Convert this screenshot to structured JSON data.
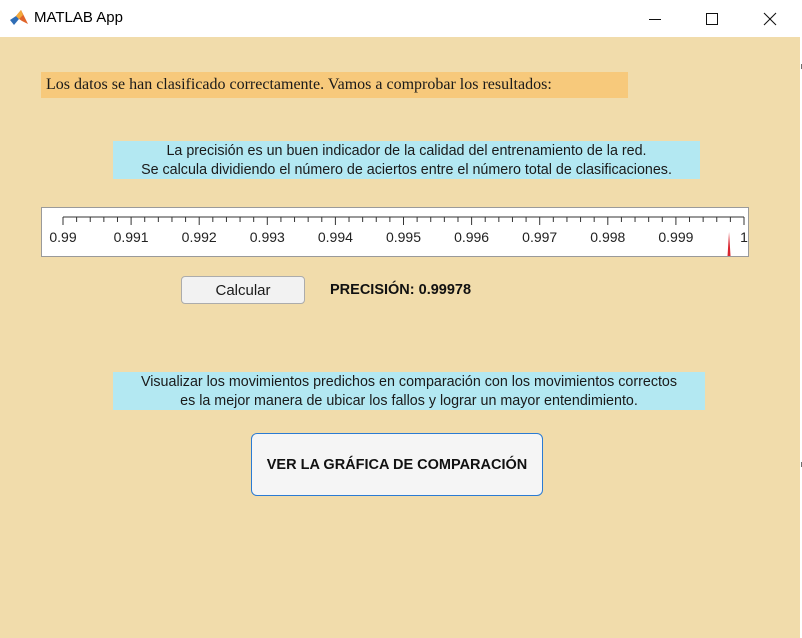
{
  "window": {
    "title": "MATLAB App",
    "controls": [
      "minimize-icon",
      "maximize-icon",
      "close-icon"
    ]
  },
  "status": {
    "text": "Los datos se han clasificado correctamente. Vamos a comprobar los resultados:"
  },
  "info_precision": {
    "line1": "La precisión es un buen indicador de la calidad del entrenamiento de la red.",
    "line2": "Se calcula dividiendo el número de aciertos entre el número total de clasificaciones."
  },
  "gauge": {
    "min": 0.99,
    "max": 1,
    "value": 0.99978,
    "major_labels": [
      "0.99",
      "0.991",
      "0.992",
      "0.993",
      "0.994",
      "0.995",
      "0.996",
      "0.997",
      "0.998",
      "0.999",
      "1"
    ],
    "minor_per_major": 5,
    "needle_color": "#d9252f"
  },
  "calc_button": {
    "label": "Calcular"
  },
  "precision": {
    "prefix": "PRECISIÓN:",
    "value": "0.99978"
  },
  "info_compare": {
    "line1": "Visualizar los movimientos predichos en comparación con los movimientos correctos",
    "line2": "es la mejor manera de ubicar los fallos y lograr un mayor entendimiento."
  },
  "compare_button": {
    "label": "VER LA GRÁFICA DE COMPARACIÓN"
  },
  "colors": {
    "background": "#f1dcab",
    "status_bg": "#f7c97b",
    "info_bg": "#b3e8f2",
    "button_border_accent": "#2b7bd3"
  }
}
